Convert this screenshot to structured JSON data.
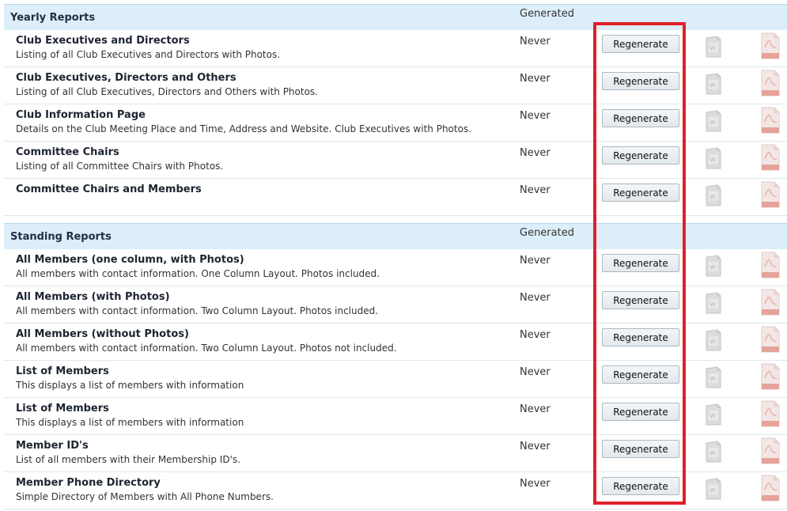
{
  "yearly": {
    "title": "Yearly Reports",
    "generated_header": "Generated",
    "rows": [
      {
        "title": "Club Executives and Directors",
        "desc": "Listing of all Club Executives and Directors with Photos.",
        "generated": "Never",
        "button": "Regenerate"
      },
      {
        "title": "Club Executives, Directors and Others",
        "desc": "Listing of all Club Executives, Directors and Others with Photos.",
        "generated": "Never",
        "button": "Regenerate"
      },
      {
        "title": "Club Information Page",
        "desc": "Details on the Club Meeting Place and Time, Address and Website. Club Executives with Photos.",
        "generated": "Never",
        "button": "Regenerate"
      },
      {
        "title": "Committee Chairs",
        "desc": "Listing of all Committee Chairs with Photos.",
        "generated": "Never",
        "button": "Regenerate"
      },
      {
        "title": "Committee Chairs and Members",
        "desc": "",
        "generated": "Never",
        "button": "Regenerate"
      }
    ]
  },
  "standing": {
    "title": "Standing Reports",
    "generated_header": "Generated",
    "rows": [
      {
        "title": "All Members (one column, with Photos)",
        "desc": "All members with contact information. One Column Layout. Photos included.",
        "generated": "Never",
        "button": "Regenerate"
      },
      {
        "title": "All Members (with Photos)",
        "desc": "All members with contact information. Two Column Layout. Photos included.",
        "generated": "Never",
        "button": "Regenerate"
      },
      {
        "title": "All Members (without Photos)",
        "desc": "All members with contact information. Two Column Layout. Photos not included.",
        "generated": "Never",
        "button": "Regenerate"
      },
      {
        "title": "List of Members",
        "desc": "This displays a list of members with information",
        "generated": "Never",
        "button": "Regenerate"
      },
      {
        "title": "List of Members",
        "desc": "This displays a list of members with information",
        "generated": "Never",
        "button": "Regenerate"
      },
      {
        "title": "Member ID's",
        "desc": "List of all members with their Membership ID's.",
        "generated": "Never",
        "button": "Regenerate"
      },
      {
        "title": "Member Phone Directory",
        "desc": "Simple Directory of Members with All Phone Numbers.",
        "generated": "Never",
        "button": "Regenerate"
      }
    ]
  },
  "icons": {
    "word": "word-document-icon",
    "pdf": "pdf-document-icon"
  },
  "colors": {
    "header_bg": "#dceef9",
    "highlight": "#e0202a",
    "pdf_red": "#d9534f"
  }
}
